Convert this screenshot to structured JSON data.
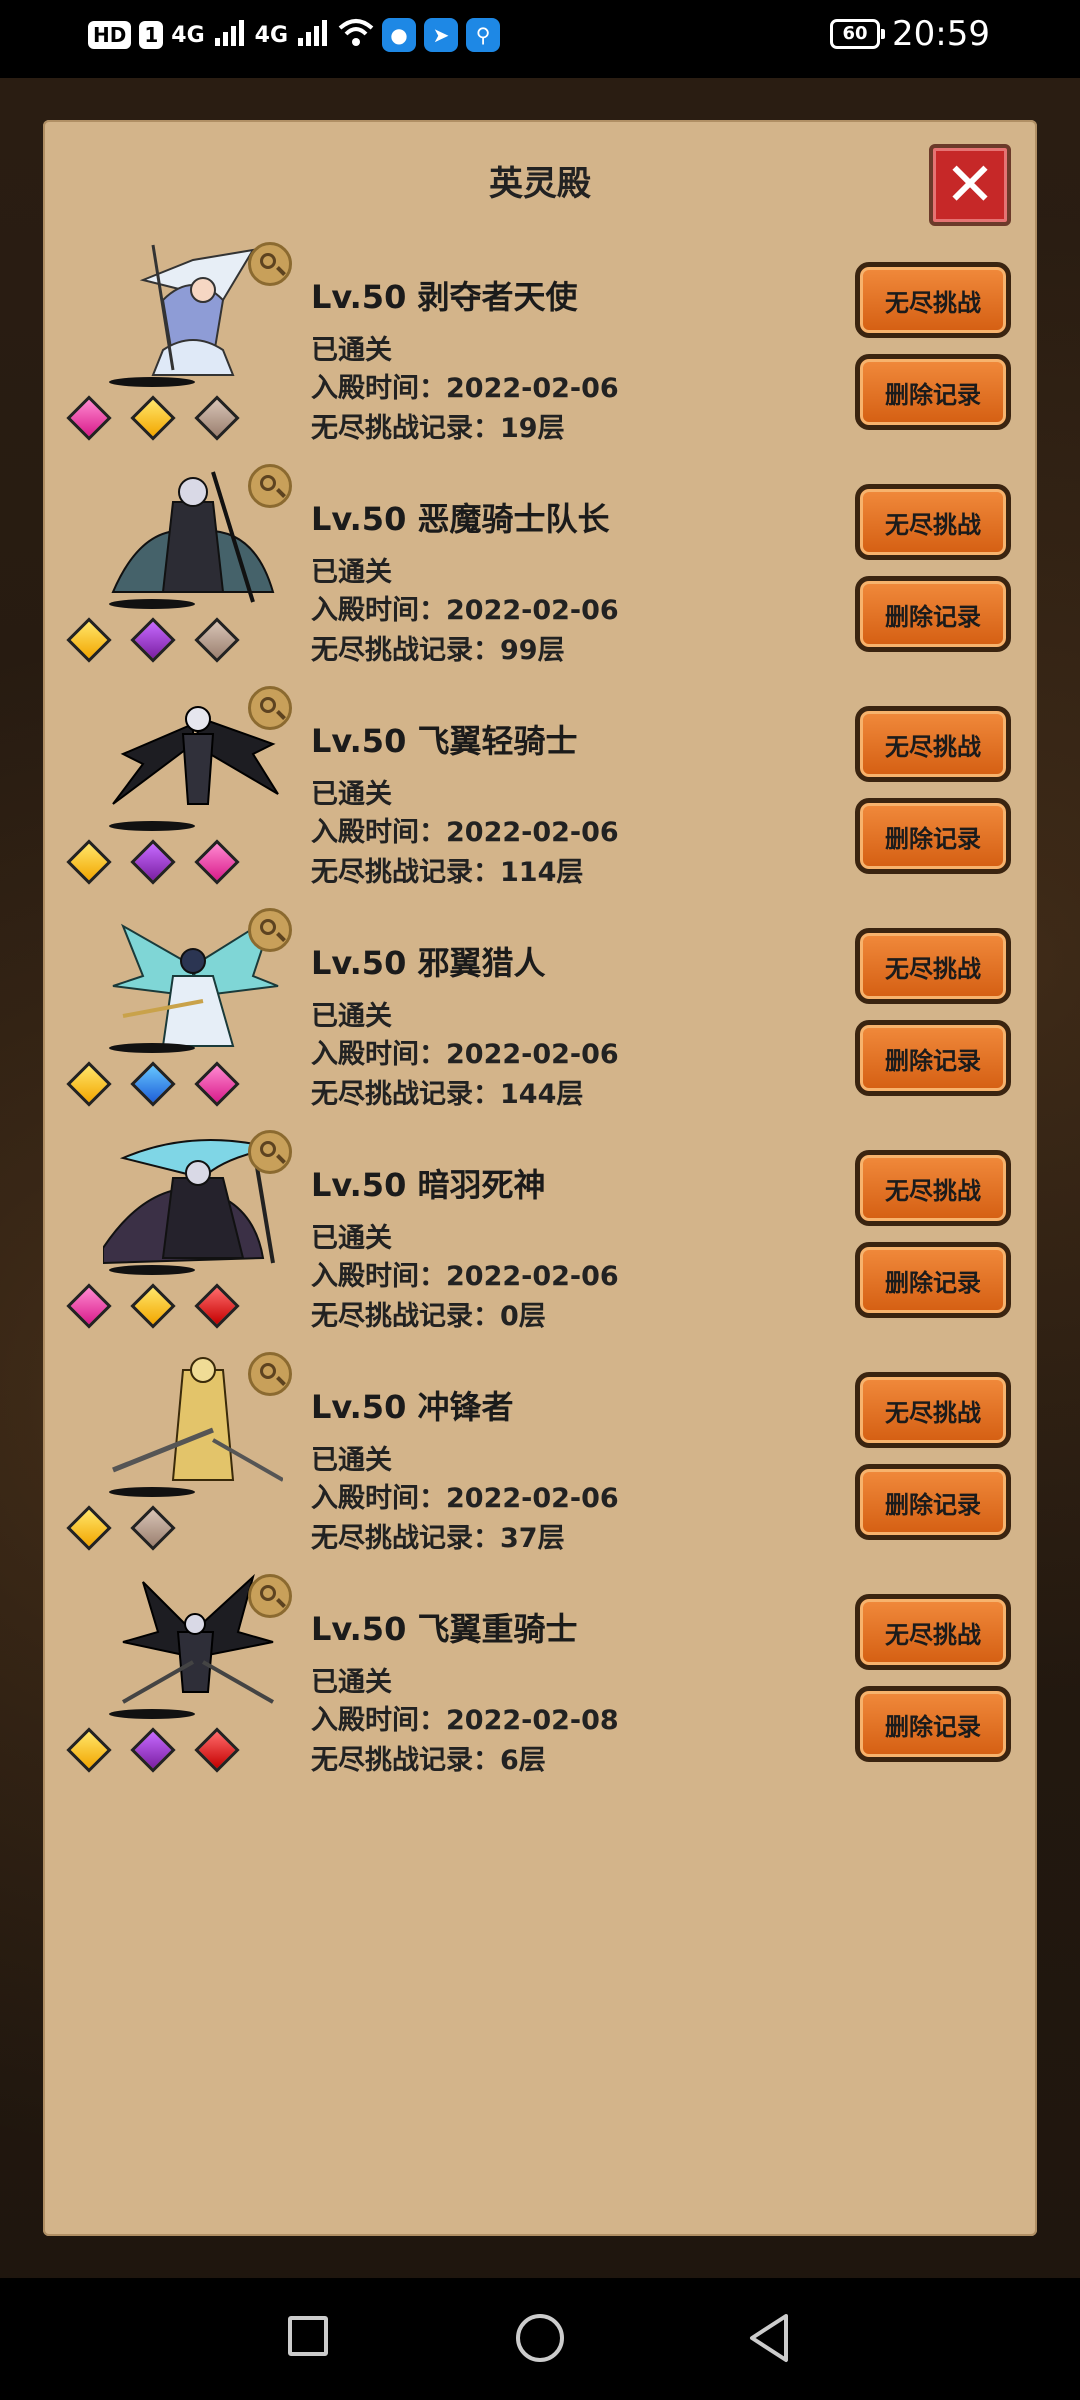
{
  "status_bar": {
    "hd_label": "HD",
    "sim1_label": "1",
    "signal_1": "4G",
    "signal_2": "4G",
    "battery": "60",
    "time": "20:59",
    "app_icons": [
      "bulb-icon",
      "paper-plane-icon",
      "search-icon"
    ]
  },
  "panel": {
    "title": "英灵殿",
    "close_icon": "close-icon",
    "challenge_label": "无尽挑战",
    "delete_label": "删除记录",
    "heroes": [
      {
        "name": "Lv.50 剥夺者天使",
        "status": "已通关",
        "enter_time": "入殿时间：2022-02-06",
        "record": "无尽挑战记录：19层",
        "gems": [
          "pink",
          "gold",
          "grey"
        ],
        "portrait": "angel-portrait"
      },
      {
        "name": "Lv.50 恶魔骑士队长",
        "status": "已通关",
        "enter_time": "入殿时间：2022-02-06",
        "record": "无尽挑战记录：99层",
        "gems": [
          "gold",
          "purple",
          "grey"
        ],
        "portrait": "demon-knight-portrait"
      },
      {
        "name": "Lv.50 飞翼轻骑士",
        "status": "已通关",
        "enter_time": "入殿时间：2022-02-06",
        "record": "无尽挑战记录：114层",
        "gems": [
          "gold",
          "purple",
          "pink"
        ],
        "portrait": "winged-light-knight-portrait"
      },
      {
        "name": "Lv.50 邪翼猎人",
        "status": "已通关",
        "enter_time": "入殿时间：2022-02-06",
        "record": "无尽挑战记录：144层",
        "gems": [
          "gold",
          "blue",
          "pink"
        ],
        "portrait": "evil-wing-hunter-portrait"
      },
      {
        "name": "Lv.50 暗羽死神",
        "status": "已通关",
        "enter_time": "入殿时间：2022-02-06",
        "record": "无尽挑战记录：0层",
        "gems": [
          "pink",
          "gold",
          "red"
        ],
        "portrait": "dark-feather-reaper-portrait"
      },
      {
        "name": "Lv.50 冲锋者",
        "status": "已通关",
        "enter_time": "入殿时间：2022-02-06",
        "record": "无尽挑战记录：37层",
        "gems": [
          "gold",
          "grey"
        ],
        "portrait": "charger-portrait"
      },
      {
        "name": "Lv.50 飞翼重骑士",
        "status": "已通关",
        "enter_time": "入殿时间：2022-02-08",
        "record": "无尽挑战记录：6层",
        "gems": [
          "gold",
          "purple",
          "red"
        ],
        "portrait": "winged-heavy-knight-portrait"
      }
    ]
  },
  "nav_bar": {
    "buttons": [
      "recent-apps-icon",
      "home-icon",
      "back-icon"
    ]
  }
}
